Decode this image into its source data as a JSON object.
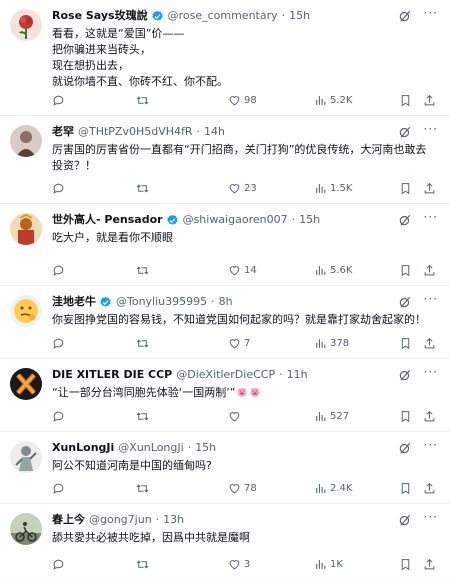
{
  "tweets": [
    {
      "name": "Rose Says玫瑰說",
      "verified": true,
      "handle": "@rose_commentary",
      "time": "15h",
      "text": "看看，这就是“爱国”价——\n把你骗进来当砖头，\n现在想扔出去，\n就说你墙不直、你砖不红、你不配。",
      "replies": "",
      "retweets": "",
      "likes": "98",
      "views": "5.2K",
      "avatar_color": "#c0392b"
    },
    {
      "name": "老罕",
      "verified": false,
      "handle": "@THtPZv0H5dVH4fR",
      "time": "14h",
      "text": "厉害国的厉害省份一直都有“开门招商，关门打狗”的优良传统，大河南也敢去投资？！",
      "replies": "",
      "retweets": "",
      "likes": "23",
      "views": "1.5K",
      "avatar_color": "#a1887f"
    },
    {
      "name": "世外高人- Pensador",
      "verified": true,
      "handle": "@shiwaigaoren007",
      "time": "15h",
      "text": "吃大户，就是看你不顺眼",
      "replies": "",
      "retweets": "",
      "likes": "14",
      "views": "5.6K",
      "avatar_color": "#b5651d"
    },
    {
      "name": "洼地老牛",
      "verified": true,
      "handle": "@Tonyliu395995",
      "time": "8h",
      "text": "你妄图挣党国的容易钱，不知道党国如何起家的吗？就是靠打家劫舍起家的！",
      "replies": "",
      "retweets": "",
      "likes": "7",
      "views": "378",
      "avatar_color": "#ffcc4d"
    },
    {
      "name": "DIE XITLER DIE CCP",
      "verified": false,
      "handle": "@DieXitlerDieCCP",
      "time": "11h",
      "text": "“让一部分台湾同胞先体验‘一国两制’”",
      "replies": "",
      "retweets": "",
      "likes": "",
      "views": "527",
      "avatar_color": "#1a1a1a"
    },
    {
      "name": "XunLongJi",
      "verified": false,
      "handle": "@XunLongJi",
      "time": "15h",
      "text": "阿公不知道河南是中国的缅甸吗?",
      "replies": "",
      "retweets": "",
      "likes": "78",
      "views": "2.4K",
      "avatar_color": "#8e8e8e"
    },
    {
      "name": "春上今",
      "verified": false,
      "handle": "@gong7jun",
      "time": "13h",
      "text": "舔共愛共必被共吃掉，因爲中共就是魔啊",
      "replies": "",
      "retweets": "",
      "likes": "3",
      "views": "1K",
      "avatar_color": "#7a8a6a"
    }
  ],
  "icons": {
    "more": "more-icon",
    "grok": "grok-icon",
    "reply": "reply-icon",
    "retweet": "retweet-icon",
    "like": "heart-icon",
    "views": "views-icon",
    "bookmark": "bookmark-icon",
    "share": "share-icon"
  },
  "more_glyph": "···",
  "colors": {
    "verified": "#1d9bf0",
    "muted": "#536471",
    "text": "#0f1419",
    "divider": "#eff3f4"
  }
}
